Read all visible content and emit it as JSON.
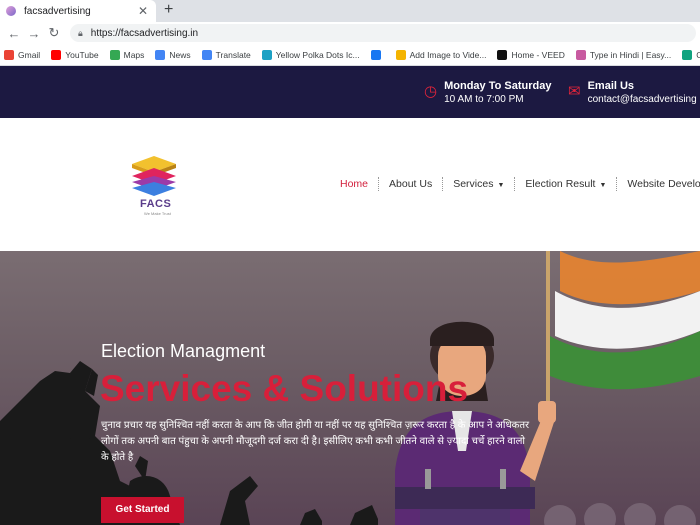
{
  "browser": {
    "tab_title": "facsadvertising",
    "tab_close": "✕",
    "new_tab": "+",
    "url": "https://facsadvertising.in",
    "bookmarks": [
      {
        "label": "Gmail",
        "color": "#ea4335"
      },
      {
        "label": "YouTube",
        "color": "#ff0000"
      },
      {
        "label": "Maps",
        "color": "#34a853"
      },
      {
        "label": "News",
        "color": "#4285f4"
      },
      {
        "label": "Translate",
        "color": "#4285f4"
      },
      {
        "label": "Yellow Polka Dots Ic...",
        "color": "#1da1c4"
      },
      {
        "label": "",
        "color": "#1877f2"
      },
      {
        "label": "Add Image to Vide...",
        "color": "#f4b400"
      },
      {
        "label": "Home - VEED",
        "color": "#111111"
      },
      {
        "label": "Type in Hindi | Easy...",
        "color": "#c85aa0"
      },
      {
        "label": "ChatGPT",
        "color": "#10a37f"
      }
    ]
  },
  "info": {
    "hours_title": "Monday To Saturday",
    "hours_value": "10 AM to 7:00 PM",
    "email_title": "Email Us",
    "email_value": "contact@facsadvertising"
  },
  "logo": {
    "name": "FACS",
    "tagline": "We Make Trust"
  },
  "nav": {
    "home": "Home",
    "about": "About Us",
    "services": "Services",
    "election": "Election Result",
    "website": "Website Developme"
  },
  "hero": {
    "subtitle": "Election Managment",
    "title": "Services & Solutions",
    "body": "चुनाव प्रचार यह सुनिश्चित नहीं करता के आप कि जीत होगी या नहीं पर यह सुनिश्चित ज़रूर करता है के आप ने अधिकतर लोगों तक अपनी बात पंहुचा के अपनी मौजूदगी दर्ज करा दी है। इसीलिए कभी कभी जीतने वाले से ज़्यादा चर्चे हारने वालो के होते है",
    "cta": "Get Started"
  },
  "colors": {
    "brand_red": "#c8102e",
    "dark_navy": "#1c1941"
  }
}
